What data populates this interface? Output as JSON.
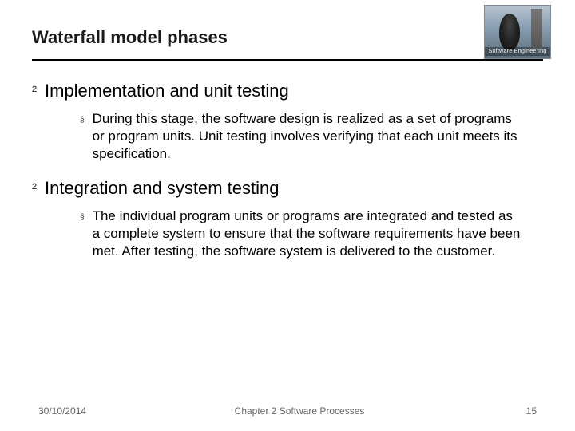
{
  "header": {
    "title": "Waterfall model phases",
    "logo_label": "Software Engineering"
  },
  "bullets": {
    "dia": "²",
    "sq": "§"
  },
  "sections": [
    {
      "heading": "Implementation and unit testing",
      "body": "During this stage, the software design is realized as a set of programs or program units. Unit testing involves verifying that each unit meets its specification."
    },
    {
      "heading": "Integration and system testing",
      "body": "The individual program units or programs are integrated and tested as a complete system to ensure that the software requirements have been met. After testing, the software system is delivered to the customer."
    }
  ],
  "footer": {
    "date": "30/10/2014",
    "chapter": "Chapter 2 Software Processes",
    "page": "15"
  }
}
